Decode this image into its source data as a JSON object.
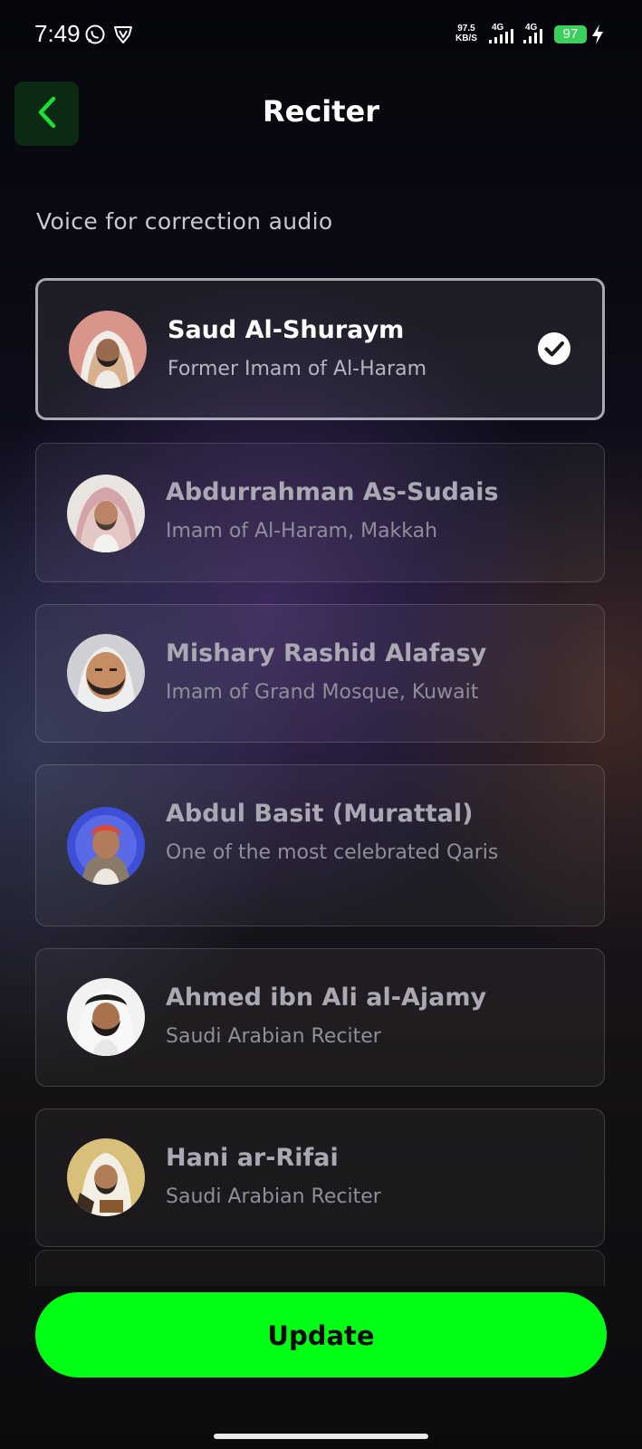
{
  "status_bar": {
    "time": "7:49",
    "net_speed_value": "97.5",
    "net_speed_unit": "KB/S",
    "signal1_label": "4G",
    "signal2_label": "4G",
    "battery_level": "97"
  },
  "header": {
    "title": "Reciter"
  },
  "section": {
    "subtitle": "Voice for correction audio"
  },
  "reciters": [
    {
      "name": "Saud Al-Shuraym",
      "description": "Former Imam of Al-Haram",
      "selected": true
    },
    {
      "name": "Abdurrahman As-Sudais",
      "description": "Imam of Al-Haram, Makkah",
      "selected": false
    },
    {
      "name": "Mishary Rashid Alafasy",
      "description": "Imam of Grand Mosque, Kuwait",
      "selected": false
    },
    {
      "name": "Abdul Basit (Murattal)",
      "description": "One of the most celebrated Qaris",
      "selected": false
    },
    {
      "name": "Ahmed ibn Ali al-Ajamy",
      "description": "Saudi Arabian Reciter",
      "selected": false
    },
    {
      "name": "Hani ar-Rifai",
      "description": "Saudi Arabian Reciter",
      "selected": false
    }
  ],
  "actions": {
    "update_label": "Update"
  },
  "colors": {
    "accent": "#00ff14",
    "back_button_bg": "#0c2a12",
    "back_icon": "#19e13a",
    "battery": "#3bcf5b"
  }
}
